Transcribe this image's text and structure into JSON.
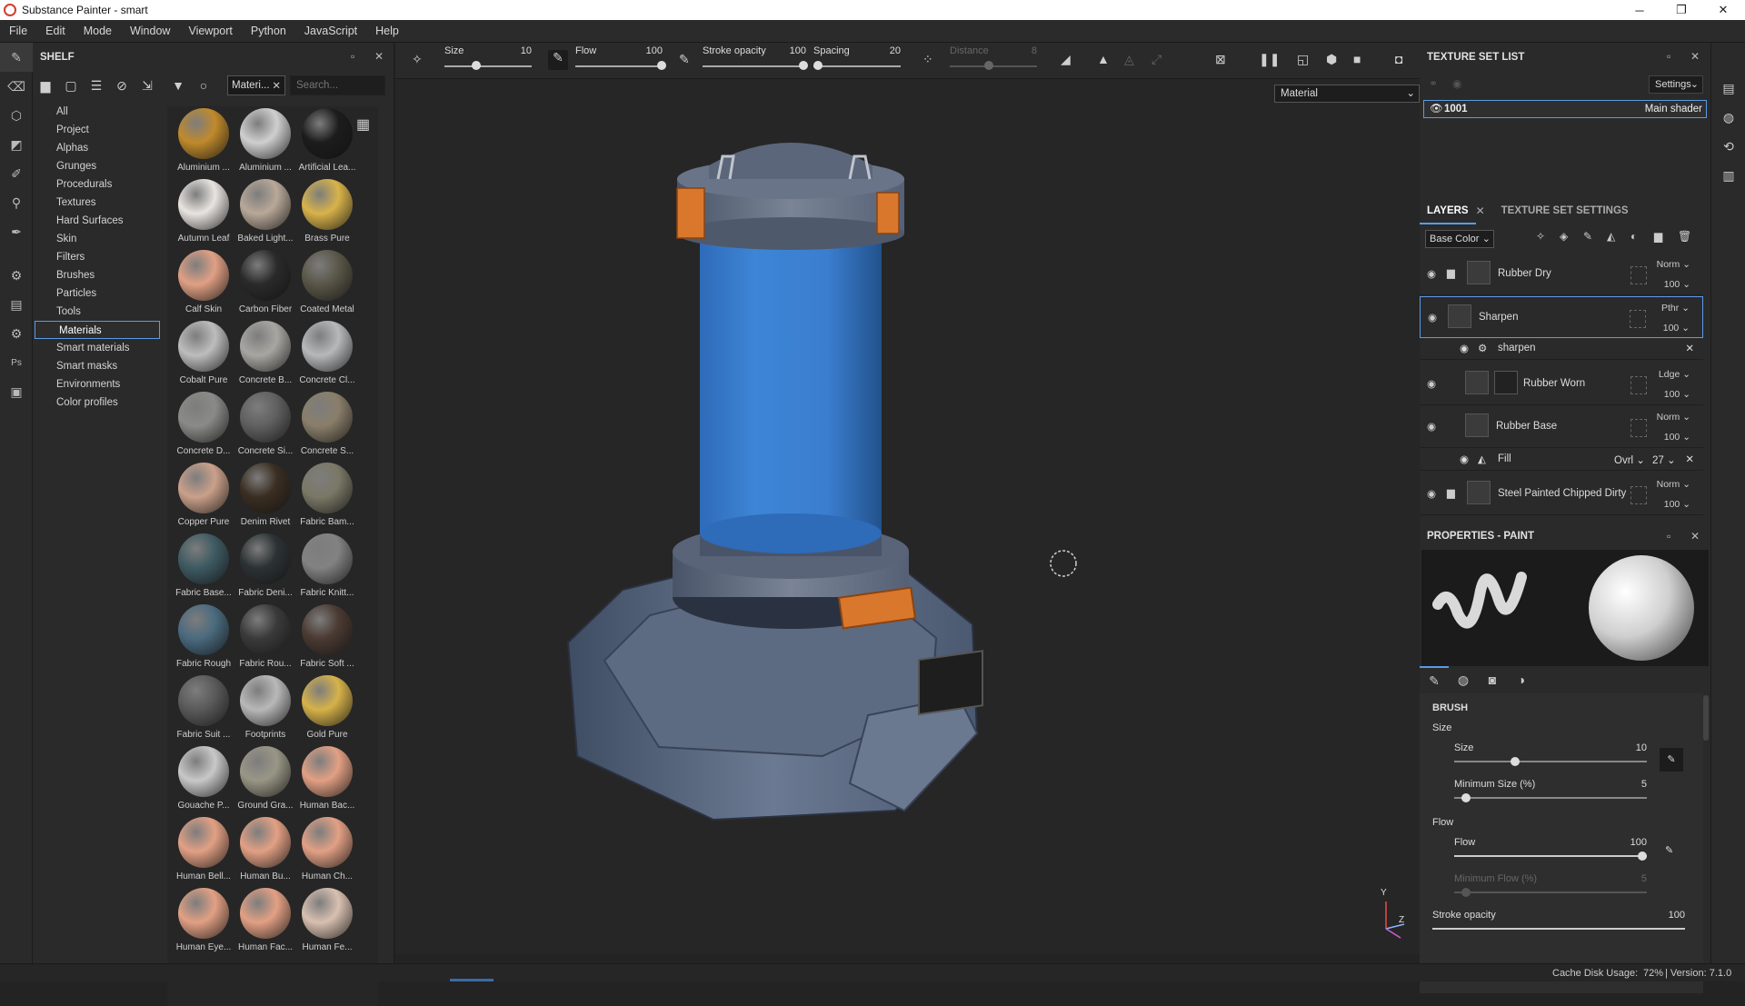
{
  "window": {
    "title": "Substance Painter - smart"
  },
  "menu": [
    "File",
    "Edit",
    "Mode",
    "Window",
    "Viewport",
    "Python",
    "JavaScript",
    "Help"
  ],
  "shelf": {
    "title": "SHELF",
    "filter_chip": "Materi...",
    "search_placeholder": "Search...",
    "categories": [
      "All",
      "Project",
      "Alphas",
      "Grunges",
      "Procedurals",
      "Textures",
      "Hard Surfaces",
      "Skin",
      "Filters",
      "Brushes",
      "Particles",
      "Tools",
      "Materials",
      "Smart materials",
      "Smart masks",
      "Environments",
      "Color profiles"
    ],
    "selected_category": "Materials",
    "materials": [
      {
        "label": "Aluminium ...",
        "color": "#c08a2c"
      },
      {
        "label": "Aluminium ...",
        "color": "#cfcfcf"
      },
      {
        "label": "Artificial Lea...",
        "color": "#1c1c1c"
      },
      {
        "label": "Autumn Leaf",
        "color": "#e8e4e0"
      },
      {
        "label": "Baked Light...",
        "color": "#b8a898"
      },
      {
        "label": "Brass Pure",
        "color": "#d8b34a"
      },
      {
        "label": "Calf Skin",
        "color": "#e0a084"
      },
      {
        "label": "Carbon Fiber",
        "color": "#2a2a2a"
      },
      {
        "label": "Coated Metal",
        "color": "#5a5648"
      },
      {
        "label": "Cobalt Pure",
        "color": "#bdbdbd"
      },
      {
        "label": "Concrete B...",
        "color": "#a8a6a2"
      },
      {
        "label": "Concrete Cl...",
        "color": "#b6b8ba"
      },
      {
        "label": "Concrete D...",
        "color": "#8a8a88"
      },
      {
        "label": "Concrete Si...",
        "color": "#606060"
      },
      {
        "label": "Concrete S...",
        "color": "#8a7e6a"
      },
      {
        "label": "Copper Pure",
        "color": "#caa08a"
      },
      {
        "label": "Denim Rivet",
        "color": "#3a2e22"
      },
      {
        "label": "Fabric Bam...",
        "color": "#7a7866"
      },
      {
        "label": "Fabric Base...",
        "color": "#3e5a62"
      },
      {
        "label": "Fabric Deni...",
        "color": "#2c3234"
      },
      {
        "label": "Fabric Knitt...",
        "color": "#828282"
      },
      {
        "label": "Fabric Rough",
        "color": "#4a6a7e"
      },
      {
        "label": "Fabric Rou...",
        "color": "#3a3a3a"
      },
      {
        "label": "Fabric Soft ...",
        "color": "#4a3a32"
      },
      {
        "label": "Fabric Suit ...",
        "color": "#5a5a5a"
      },
      {
        "label": "Footprints",
        "color": "#b8b8b8"
      },
      {
        "label": "Gold Pure",
        "color": "#d6b24a"
      },
      {
        "label": "Gouache P...",
        "color": "#c8c8c8"
      },
      {
        "label": "Ground Gra...",
        "color": "#9a9686"
      },
      {
        "label": "Human Bac...",
        "color": "#e2a084"
      },
      {
        "label": "Human Bell...",
        "color": "#e2a084"
      },
      {
        "label": "Human Bu...",
        "color": "#e2a084"
      },
      {
        "label": "Human Ch...",
        "color": "#e2a084"
      },
      {
        "label": "Human Eye...",
        "color": "#e2a084"
      },
      {
        "label": "Human Fac...",
        "color": "#e2a084"
      },
      {
        "label": "Human Fe...",
        "color": "#d8c0b0"
      }
    ]
  },
  "toolbar": {
    "size_label": "Size",
    "size_value": "10",
    "flow_label": "Flow",
    "flow_value": "100",
    "stroke_label": "Stroke opacity",
    "stroke_value": "100",
    "spacing_label": "Spacing",
    "spacing_value": "20",
    "distance_label": "Distance",
    "distance_value": "8"
  },
  "viewport": {
    "channel_select": "Material",
    "axis_y": "Y",
    "axis_z": "Z"
  },
  "texture_set_list": {
    "title": "TEXTURE SET LIST",
    "settings_label": "Settings",
    "row_name": "1001",
    "row_shader": "Main shader"
  },
  "layers_panel": {
    "tab_layers": "LAYERS",
    "tab_tss": "TEXTURE SET SETTINGS",
    "channel": "Base Color",
    "layers": [
      {
        "name": "Rubber Dry",
        "mode": "Norm",
        "opacity": "100",
        "folder": true,
        "mask_count": "1"
      },
      {
        "name": "Sharpen",
        "mode": "Pthr",
        "opacity": "100",
        "folder": false,
        "selected": true
      },
      {
        "name": "Rubber Worn",
        "mode": "Ldge",
        "opacity": "100",
        "folder": false
      },
      {
        "name": "Rubber Base",
        "mode": "Norm",
        "opacity": "100",
        "folder": false
      },
      {
        "name": "Steel Painted Chipped Dirty",
        "mode": "Norm",
        "opacity": "100",
        "folder": true,
        "mask_count": "1"
      }
    ],
    "sharpen_effect": "sharpen",
    "fill_effect": {
      "name": "Fill",
      "mode": "Ovrl",
      "value": "27"
    }
  },
  "properties": {
    "title": "PROPERTIES - PAINT",
    "section_brush": "BRUSH",
    "size_group": "Size",
    "size_label": "Size",
    "size_value": "10",
    "min_size_label": "Minimum Size (%)",
    "min_size_value": "5",
    "flow_group": "Flow",
    "flow_label": "Flow",
    "flow_value": "100",
    "min_flow_label": "Minimum Flow (%)",
    "min_flow_value": "5",
    "stroke_label": "Stroke opacity",
    "stroke_value": "100"
  },
  "status": {
    "cache": "Cache Disk Usage:",
    "pct": "72%",
    "version": "| Version: 7.1.0"
  }
}
